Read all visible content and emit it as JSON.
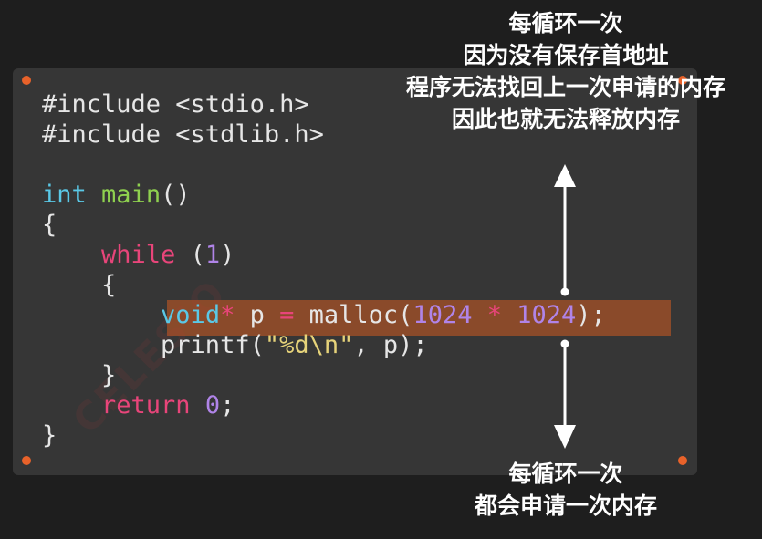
{
  "code_lines": [
    {
      "parts": [
        {
          "t": "#include <stdio.h>",
          "c": ""
        }
      ]
    },
    {
      "parts": [
        {
          "t": "#include <stdlib.h>",
          "c": ""
        }
      ]
    },
    {
      "parts": [
        {
          "t": "",
          "c": ""
        }
      ]
    },
    {
      "parts": [
        {
          "t": "int",
          "c": "kw-type"
        },
        {
          "t": " ",
          "c": ""
        },
        {
          "t": "main",
          "c": "kw-func"
        },
        {
          "t": "()",
          "c": ""
        }
      ]
    },
    {
      "parts": [
        {
          "t": "{",
          "c": ""
        }
      ]
    },
    {
      "parts": [
        {
          "t": "    ",
          "c": ""
        },
        {
          "t": "while",
          "c": "kw-ctrl"
        },
        {
          "t": " (",
          "c": ""
        },
        {
          "t": "1",
          "c": "num"
        },
        {
          "t": ")",
          "c": ""
        }
      ]
    },
    {
      "parts": [
        {
          "t": "    {",
          "c": ""
        }
      ]
    },
    {
      "parts": [
        {
          "t": "        ",
          "c": ""
        },
        {
          "t": "void",
          "c": "kw-type"
        },
        {
          "t": "*",
          "c": "op"
        },
        {
          "t": " p ",
          "c": ""
        },
        {
          "t": "=",
          "c": "op"
        },
        {
          "t": " malloc(",
          "c": ""
        },
        {
          "t": "1024",
          "c": "num"
        },
        {
          "t": " ",
          "c": ""
        },
        {
          "t": "*",
          "c": "op"
        },
        {
          "t": " ",
          "c": ""
        },
        {
          "t": "1024",
          "c": "num"
        },
        {
          "t": ");",
          "c": ""
        }
      ]
    },
    {
      "parts": [
        {
          "t": "        printf(",
          "c": ""
        },
        {
          "t": "\"%d\\n\"",
          "c": "str"
        },
        {
          "t": ", p);",
          "c": ""
        }
      ]
    },
    {
      "parts": [
        {
          "t": "    }",
          "c": ""
        }
      ]
    },
    {
      "parts": [
        {
          "t": "    ",
          "c": ""
        },
        {
          "t": "return",
          "c": "kw-ctrl"
        },
        {
          "t": " ",
          "c": ""
        },
        {
          "t": "0",
          "c": "num"
        },
        {
          "t": ";",
          "c": ""
        }
      ]
    },
    {
      "parts": [
        {
          "t": "}",
          "c": ""
        }
      ]
    }
  ],
  "annotation_top": {
    "lines": [
      "每循环一次",
      "因为没有保存首地址",
      "程序无法找回上一次申请的内存",
      "因此也就无法释放内存"
    ]
  },
  "annotation_bottom": {
    "lines": [
      "每循环一次",
      "都会申请一次内存"
    ]
  },
  "watermark": "CELESIO",
  "colors": {
    "background": "#1e1e1e",
    "panel": "#363636",
    "highlight": "#8a4a2a",
    "dot": "#e8622a",
    "arrow": "#ffffff"
  }
}
